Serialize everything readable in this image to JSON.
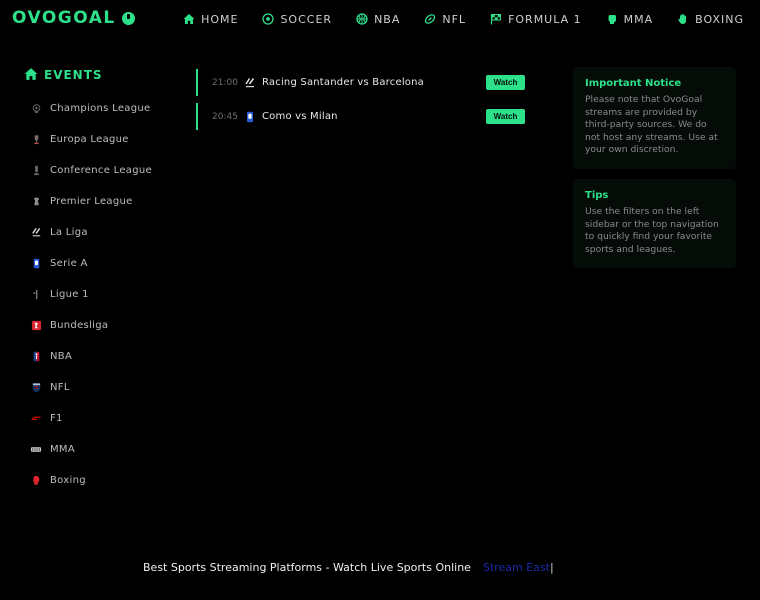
{
  "logo": {
    "text": "OVOGOAL"
  },
  "nav": [
    {
      "label": "HOME",
      "icon": "home-icon"
    },
    {
      "label": "SOCCER",
      "icon": "soccer-ball-icon"
    },
    {
      "label": "NBA",
      "icon": "basketball-icon"
    },
    {
      "label": "NFL",
      "icon": "football-icon"
    },
    {
      "label": "FORMULA 1",
      "icon": "checkered-flag-icon"
    },
    {
      "label": "MMA",
      "icon": "fist-icon"
    },
    {
      "label": "BOXING",
      "icon": "hand-icon"
    }
  ],
  "sidebar": {
    "title": "EVENTS",
    "items": [
      {
        "label": "Champions League",
        "icon": "champions-league-icon"
      },
      {
        "label": "Europa League",
        "icon": "europa-league-icon"
      },
      {
        "label": "Conference League",
        "icon": "conference-league-icon"
      },
      {
        "label": "Premier League",
        "icon": "premier-league-icon"
      },
      {
        "label": "La Liga",
        "icon": "la-liga-icon"
      },
      {
        "label": "Serie A",
        "icon": "serie-a-icon"
      },
      {
        "label": "Ligue 1",
        "icon": "ligue-1-icon"
      },
      {
        "label": "Bundesliga",
        "icon": "bundesliga-icon"
      },
      {
        "label": "NBA",
        "icon": "nba-icon"
      },
      {
        "label": "NFL",
        "icon": "nfl-icon"
      },
      {
        "label": "F1",
        "icon": "f1-icon"
      },
      {
        "label": "MMA",
        "icon": "mma-icon"
      },
      {
        "label": "Boxing",
        "icon": "boxing-icon"
      }
    ]
  },
  "events": [
    {
      "time": "21:00",
      "name": "Racing Santander vs Barcelona",
      "watch": "Watch",
      "icon": "la-liga-icon"
    },
    {
      "time": "20:45",
      "name": "Como vs Milan",
      "watch": "Watch",
      "icon": "serie-a-icon"
    }
  ],
  "notices": {
    "important": {
      "title": "Important Notice",
      "text": "Please note that OvoGoal streams are provided by third-party sources. We do not host any streams. Use at your own discretion."
    },
    "tips": {
      "title": "Tips",
      "text": "Use the filters on the left sidebar or the top navigation to quickly find your favorite sports and leagues."
    }
  },
  "footer": {
    "line": "Best Sports Streaming Platforms - Watch Live Sports Online",
    "link": "Stream East",
    "pipe": "|"
  },
  "colors": {
    "accent": "#2de08a",
    "background": "#000000",
    "card": "#050b07",
    "link": "#1a2aa8"
  }
}
